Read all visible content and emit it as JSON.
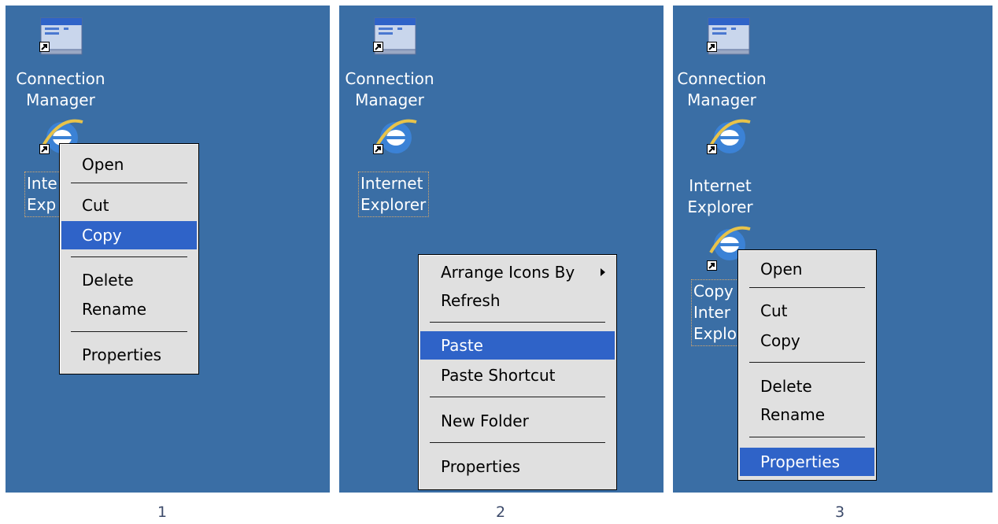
{
  "panels": [
    {
      "caption": "1",
      "icons": {
        "connection_manager": "Connection\nManager",
        "ie_line1": "Inte",
        "ie_line2": "Exp"
      },
      "menu": {
        "items": [
          "Open",
          "Cut",
          "Copy",
          "Delete",
          "Rename",
          "Properties"
        ],
        "highlighted": "Copy"
      }
    },
    {
      "caption": "2",
      "icons": {
        "connection_manager_1": "Connection",
        "connection_manager_2": "Manager",
        "ie_line1": "Internet",
        "ie_line2": "Explorer"
      },
      "menu": {
        "items": [
          "Arrange Icons By",
          "Refresh",
          "Paste",
          "Paste Shortcut",
          "New Folder",
          "Properties"
        ],
        "highlighted": "Paste"
      }
    },
    {
      "caption": "3",
      "icons": {
        "connection_manager_1": "Connection",
        "connection_manager_2": "Manager",
        "ie_line1": "Internet",
        "ie_line2": "Explorer",
        "copy_line1": "Copy",
        "copy_line2": "Inter",
        "copy_line3": "Explo"
      },
      "menu": {
        "items": [
          "Open",
          "Cut",
          "Copy",
          "Delete",
          "Rename",
          "Properties"
        ],
        "highlighted": "Properties"
      }
    }
  ],
  "p1_cm_1": "Connection",
  "p1_cm_2": "Manager",
  "colors": {
    "desktop": "#3a6ea5",
    "highlight": "#2f63c8",
    "menu": "#e0e0e0"
  }
}
